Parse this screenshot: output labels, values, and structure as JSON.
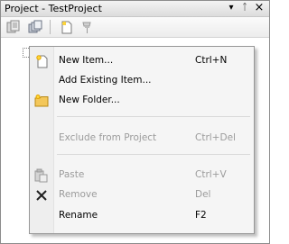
{
  "window": {
    "title": "Project - TestProject",
    "dropdown_glyph": "▾",
    "pin_glyph": "ᛏ",
    "close_glyph": "×"
  },
  "toolbar": {
    "buttons": [
      {
        "name": "properties-icon"
      },
      {
        "name": "show-all-files-icon"
      },
      {
        "name": "new-item-icon"
      },
      {
        "name": "pin-icon"
      }
    ]
  },
  "context_menu": {
    "items": [
      {
        "label": "New Item...",
        "shortcut": "Ctrl+N",
        "icon": "new-item-icon",
        "enabled": true
      },
      {
        "label": "Add Existing Item...",
        "shortcut": "",
        "icon": "",
        "enabled": true
      },
      {
        "label": "New Folder...",
        "shortcut": "",
        "icon": "new-folder-icon",
        "enabled": true
      },
      {
        "label": "Exclude from Project",
        "shortcut": "Ctrl+Del",
        "icon": "",
        "enabled": false
      },
      {
        "label": "Paste",
        "shortcut": "Ctrl+V",
        "icon": "paste-icon",
        "enabled": false
      },
      {
        "label": "Remove",
        "shortcut": "Del",
        "icon": "remove-icon",
        "enabled": false
      },
      {
        "label": "Rename",
        "shortcut": "F2",
        "icon": "",
        "enabled": true
      }
    ]
  }
}
